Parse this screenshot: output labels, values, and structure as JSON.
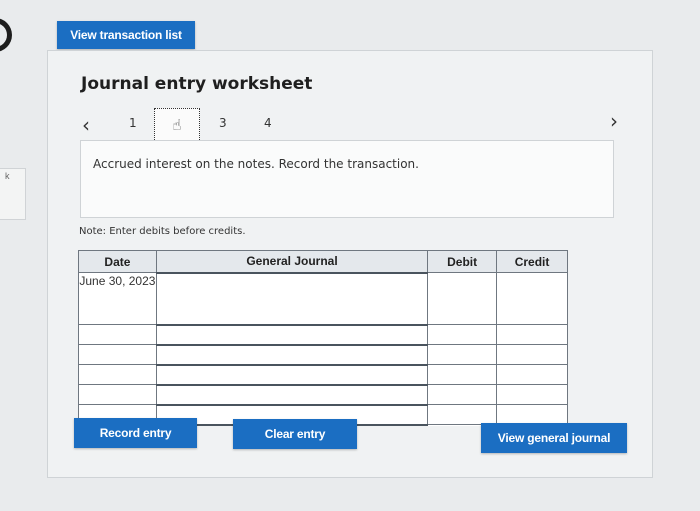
{
  "top": {
    "view_transaction_list_label": "View transaction list"
  },
  "left_panel": {
    "fragment_text": "k"
  },
  "worksheet": {
    "title": "Journal entry worksheet",
    "nav": {
      "prev_icon": "chevron-left-icon",
      "next_icon": "chevron-right-icon",
      "steps": [
        "1",
        "2",
        "3",
        "4"
      ],
      "current_step": 2
    },
    "description": "Accrued interest on the notes. Record the transaction.",
    "note": "Note: Enter debits before credits.",
    "table": {
      "headers": {
        "date": "Date",
        "general_journal": "General Journal",
        "debit": "Debit",
        "credit": "Credit"
      },
      "rows": [
        {
          "date": "June 30, 2023",
          "account": "",
          "debit": "",
          "credit": ""
        },
        {
          "date": "",
          "account": "",
          "debit": "",
          "credit": ""
        },
        {
          "date": "",
          "account": "",
          "debit": "",
          "credit": ""
        },
        {
          "date": "",
          "account": "",
          "debit": "",
          "credit": ""
        },
        {
          "date": "",
          "account": "",
          "debit": "",
          "credit": ""
        },
        {
          "date": "",
          "account": "",
          "debit": "",
          "credit": ""
        }
      ]
    },
    "buttons": {
      "record_entry": "Record entry",
      "clear_entry": "Clear entry",
      "view_general_journal": "View general journal"
    }
  },
  "colors": {
    "accent": "#1b6ec2",
    "header_bg": "#e4e8ec",
    "sheet_bg": "#f0f2f3"
  }
}
